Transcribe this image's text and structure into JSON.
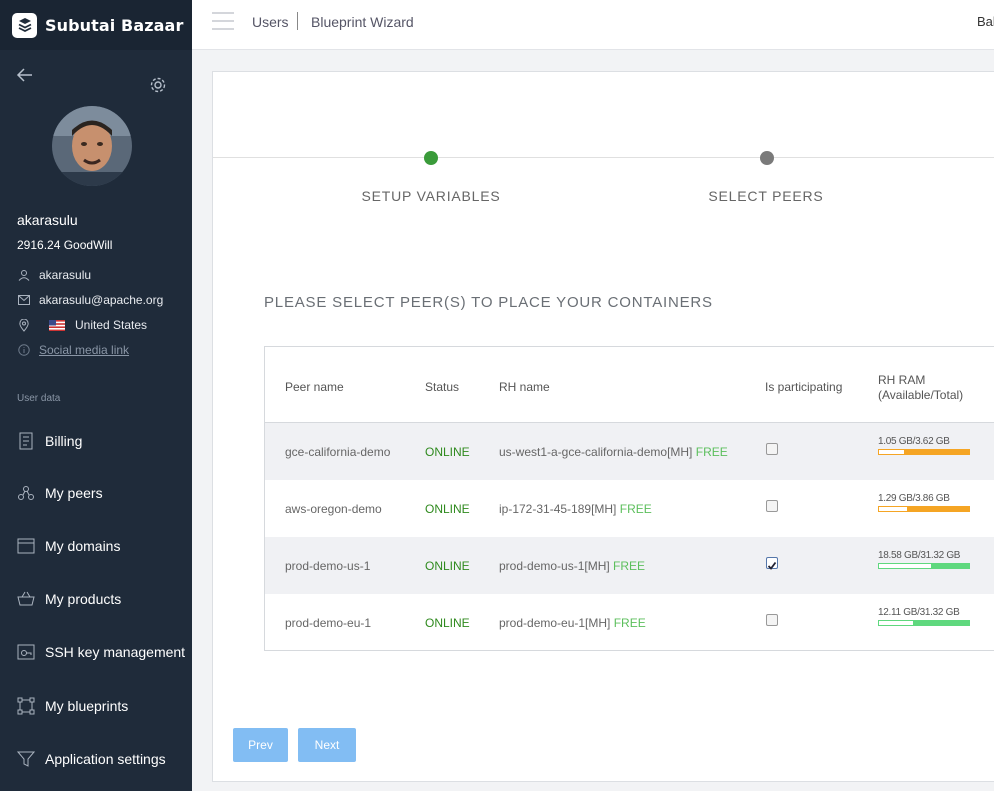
{
  "app": {
    "brand": "Subutai Bazaar"
  },
  "profile": {
    "name": "akarasulu",
    "goodwill": "2916.24 GoodWill",
    "username": "akarasulu",
    "email": "akarasulu@apache.org",
    "country": "United States",
    "social_link": "Social media link"
  },
  "sidebar": {
    "section_label": "User data",
    "items": [
      {
        "label": "Billing",
        "icon": "billing-icon"
      },
      {
        "label": "My peers",
        "icon": "peers-icon"
      },
      {
        "label": "My domains",
        "icon": "domains-icon"
      },
      {
        "label": "My products",
        "icon": "products-icon"
      },
      {
        "label": "SSH key management",
        "icon": "key-icon"
      },
      {
        "label": "My blueprints",
        "icon": "blueprints-icon"
      },
      {
        "label": "Application settings",
        "icon": "filter-icon"
      }
    ]
  },
  "header": {
    "breadcrumb": [
      "Users",
      "Blueprint Wizard"
    ],
    "right_text": "Bal"
  },
  "wizard": {
    "steps": [
      {
        "label": "SETUP VARIABLES",
        "status": "done",
        "color": "#3a9b3a"
      },
      {
        "label": "SELECT PEERS",
        "status": "pending",
        "color": "#7a7a7a"
      }
    ],
    "section_title": "PLEASE SELECT PEER(S) TO PLACE YOUR CONTAINERS",
    "table": {
      "columns": [
        "Peer name",
        "Status",
        "RH name",
        "Is participating",
        "RH RAM",
        "(Available/Total)"
      ],
      "rows": [
        {
          "peer": "gce-california-demo",
          "status": "ONLINE",
          "rh": "us-west1-a-gce-california-demo[MH]",
          "tag": "FREE",
          "checked": false,
          "ram": "1.05 GB/3.62 GB",
          "avail_fraction": 0.29,
          "bar_color": "#f5a524"
        },
        {
          "peer": "aws-oregon-demo",
          "status": "ONLINE",
          "rh": "ip-172-31-45-189[MH]",
          "tag": "FREE",
          "checked": false,
          "ram": "1.29 GB/3.86 GB",
          "avail_fraction": 0.33,
          "bar_color": "#f5a524"
        },
        {
          "peer": "prod-demo-us-1",
          "status": "ONLINE",
          "rh": "prod-demo-us-1[MH]",
          "tag": "FREE",
          "checked": true,
          "ram": "18.58 GB/31.32 GB",
          "avail_fraction": 0.59,
          "bar_color": "#5fd87e"
        },
        {
          "peer": "prod-demo-eu-1",
          "status": "ONLINE",
          "rh": "prod-demo-eu-1[MH]",
          "tag": "FREE",
          "checked": false,
          "ram": "12.11 GB/31.32 GB",
          "avail_fraction": 0.39,
          "bar_color": "#5fd87e"
        }
      ]
    },
    "buttons": {
      "prev": "Prev",
      "next": "Next"
    }
  }
}
